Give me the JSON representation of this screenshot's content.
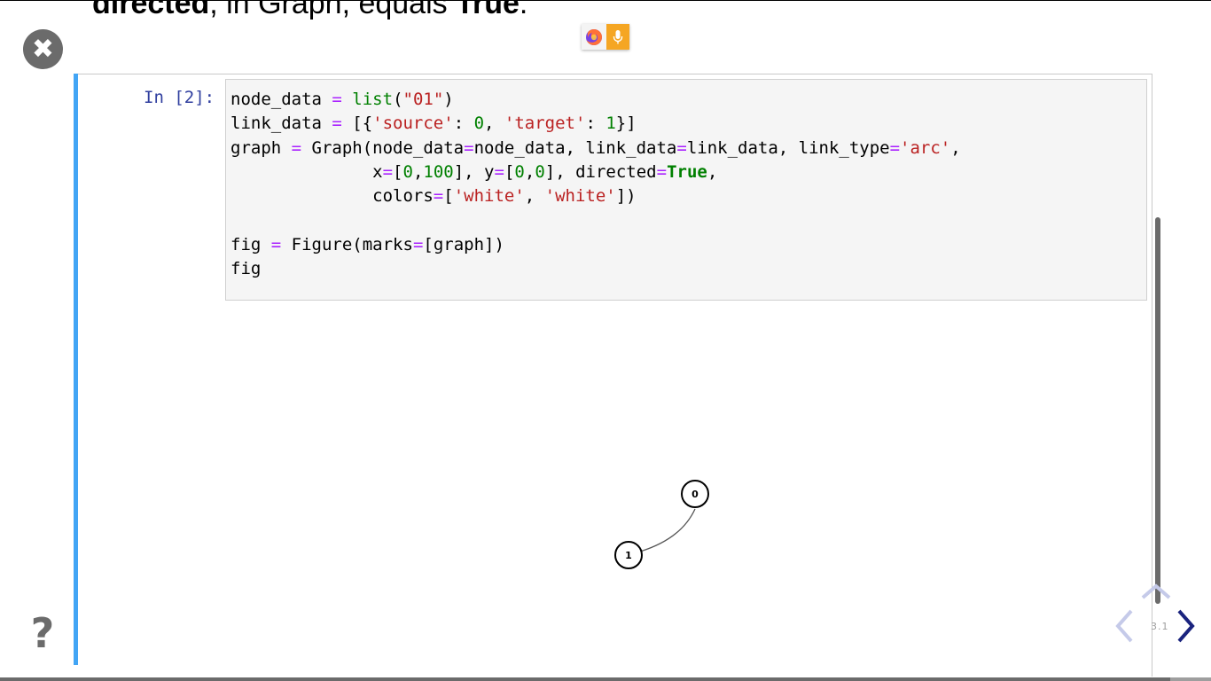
{
  "heading": {
    "bold_start": "directed",
    "middle": ", in Graph, equals ",
    "bold_end": "True",
    "end": "."
  },
  "controls": {
    "close_glyph": "✖",
    "help_glyph": "?"
  },
  "extensions": {
    "firefox_icon": "firefox-icon",
    "mic_icon": "microphone-icon",
    "mic_color": "#f5a623"
  },
  "cell": {
    "prompt": "In [2]:",
    "accent_color": "#42a5f5",
    "code": [
      [
        "node_data ",
        "=",
        " ",
        "list",
        "(",
        "\"01\"",
        ")"
      ],
      [
        "link_data ",
        "=",
        " [{",
        "'source'",
        ": ",
        "0",
        ", ",
        "'target'",
        ": ",
        "1",
        "}]"
      ],
      [
        "graph ",
        "=",
        " Graph(node_data",
        "=",
        "node_data, link_data",
        "=",
        "link_data, link_type",
        "=",
        "'arc'",
        ","
      ],
      [
        "              x",
        "=",
        "[",
        "0",
        ",",
        "100",
        "], y",
        "=",
        "[",
        "0",
        ",",
        "0",
        "], directed",
        "=",
        "True",
        ","
      ],
      [
        "              colors",
        "=",
        "[",
        "'white'",
        ", ",
        "'white'",
        "])"
      ],
      [
        ""
      ],
      [
        "fig ",
        "=",
        " Figure(marks",
        "=",
        "[graph])"
      ],
      [
        "fig"
      ]
    ]
  },
  "output_graph": {
    "nodes": [
      {
        "label": "0",
        "fill": "white"
      },
      {
        "label": "1",
        "fill": "white"
      }
    ],
    "links": [
      {
        "source": "0",
        "target": "1",
        "type": "arc"
      }
    ]
  },
  "navigation": {
    "slide_number": "3.1",
    "up_color": "#c5cae9",
    "left_color": "#c5cae9",
    "right_color": "#1a237e"
  }
}
